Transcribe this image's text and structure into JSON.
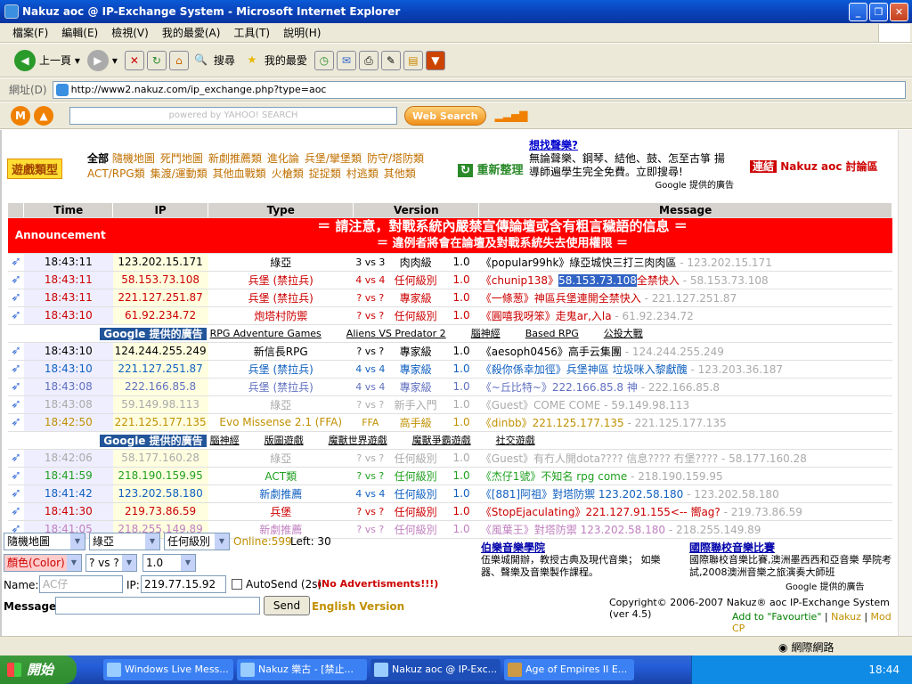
{
  "window": {
    "title": "Nakuz aoc @ IP-Exchange System - Microsoft Internet Explorer",
    "menu": [
      "檔案(F)",
      "編輯(E)",
      "檢視(V)",
      "我的最愛(A)",
      "工具(T)",
      "說明(H)"
    ],
    "toolbar": {
      "back": "上一頁",
      "search": "搜尋",
      "favorites": "我的最愛"
    },
    "address_label": "網址(D)",
    "url": "http://www2.nakuz.com/ip_exchange.php?type=aoc",
    "yahoo_placeholder": "powered by YAHOO! SEARCH",
    "web_search": "Web Search",
    "status_zone": "網際網路"
  },
  "header": {
    "category_badge": "遊戲類型",
    "all": "全部",
    "categories": [
      "隨機地圖",
      "死鬥地圖",
      "新劇推薦類",
      "進化論",
      "兵堡/攣堡類",
      "防守/塔防類",
      "ACT/RPG類",
      "集渡/運動類",
      "其他血戰類",
      "火槍類",
      "捉捉類",
      "村逃類",
      "其他類"
    ],
    "refresh": "重新整理",
    "ad_title": "想找聲樂?",
    "ad_body": "無論聲樂、鋼琴、結他、鼓、怎至古箏 揚 導師遍學生完全免費。立即搜尋!",
    "ad_by": "Google 提供的廣告",
    "link_label": "連結",
    "link_text": "Nakuz aoc 討論區"
  },
  "table": {
    "headers": [
      "Time",
      "IP",
      "Type",
      "Version",
      "Message"
    ],
    "announcement_label": "Announcement",
    "announcement_1": "＝ 請注意，對戰系統內嚴禁宣傳論壇或含有粗言穢語的信息 ＝",
    "announcement_2": "＝ 違例者將會在論壇及對戰系統失去使用權限 ＝",
    "rows_a": [
      {
        "time": "18:43:11",
        "ip": "123.202.15.171",
        "type": "綠亞",
        "mode": "3 vs 3",
        "level": "肉肉級",
        "ver": "1.0",
        "msg": "《popular99hk》綠亞城快三打三肉肉區",
        "trail": " - 123.202.15.171",
        "color": "#000000"
      },
      {
        "time": "18:43:11",
        "ip": "58.153.73.108",
        "type": "兵堡 (禁拉兵)",
        "mode": "4 vs 4",
        "level": "任何級別",
        "ver": "1.0",
        "msg": "《chunip138》",
        "msg_sel": "58.153.73.108",
        "msg_tail": "全禁快入",
        "trail": " - 58.153.73.108",
        "color": "#cc0000"
      },
      {
        "time": "18:43:11",
        "ip": "221.127.251.87",
        "type": "兵堡 (禁拉兵)",
        "mode": "? vs ?",
        "level": "專家級",
        "ver": "1.0",
        "msg": "《一條葱》神區兵堡連開全禁快入",
        "trail": " - 221.127.251.87",
        "color": "#cc0000"
      },
      {
        "time": "18:43:10",
        "ip": "61.92.234.72",
        "type": "炮塔村防禦",
        "mode": "? vs ?",
        "level": "任何級別",
        "ver": "1.0",
        "msg": "《圓嘻我呀笨》走鬼ar,入la",
        "trail": " - 61.92.234.72",
        "color": "#cc0000"
      }
    ],
    "ad1": {
      "google": "Google 提供的廣告",
      "links": [
        "RPG Adventure Games",
        "Aliens VS Predator 2",
        "腦神經",
        "Based RPG",
        "公投大戰"
      ]
    },
    "rows_b": [
      {
        "time": "18:43:10",
        "ip": "124.244.255.249",
        "type": "新信長RPG",
        "mode": "? vs ?",
        "level": "專家級",
        "ver": "1.0",
        "msg": "《aesoph0456》高手云集團",
        "trail": " - 124.244.255.249",
        "color": "#000000"
      },
      {
        "time": "18:43:10",
        "ip": "221.127.251.87",
        "type": "兵堡 (禁拉兵)",
        "mode": "4 vs 4",
        "level": "專家級",
        "ver": "1.0",
        "msg": "《殺你係幸加徑》兵堡神區 垃圾咪入黎獻醜",
        "trail": " - 123.203.36.187",
        "color": "#1060c0"
      },
      {
        "time": "18:43:08",
        "ip": "222.166.85.8",
        "type": "兵堡 (禁拉兵)",
        "mode": "4 vs 4",
        "level": "專家級",
        "ver": "1.0",
        "msg": "《~丘比特~》222.166.85.8 神",
        "trail": " - 222.166.85.8",
        "color": "#6070c0"
      },
      {
        "time": "18:43:08",
        "ip": "59.149.98.113",
        "type": "綠亞",
        "mode": "? vs ?",
        "level": "新手入門",
        "ver": "1.0",
        "msg": "《Guest》COME COME",
        "trail": " - 59.149.98.113",
        "color": "#aaaaaa"
      },
      {
        "time": "18:42:50",
        "ip": "221.125.177.135",
        "type": "Evo Missense 2.1 (FFA)",
        "mode": "FFA",
        "level": "高手級",
        "ver": "1.0",
        "msg": "《dinbb》221.125.177.135",
        "trail": " - 221.125.177.135",
        "color": "#c09000"
      }
    ],
    "ad2": {
      "google": "Google 提供的廣告",
      "links": [
        "腦神經",
        "版圖遊戲",
        "魔獸世界遊戲",
        "魔獸爭霸遊戲",
        "社交遊戲"
      ]
    },
    "rows_c": [
      {
        "time": "18:42:06",
        "ip": "58.177.160.28",
        "type": "綠亞",
        "mode": "? vs ?",
        "level": "任何級別",
        "ver": "1.0",
        "msg": "《Guest》有冇人開dota???? 信息???? 冇堡????",
        "trail": " - 58.177.160.28",
        "color": "#aaaaaa"
      },
      {
        "time": "18:41:59",
        "ip": "218.190.159.95",
        "type": "ACT類",
        "mode": "? vs ?",
        "level": "任何級別",
        "ver": "1.0",
        "msg": "《杰仔1號》不知名 rpg come",
        "trail": " - 218.190.159.95",
        "color": "#20a020"
      },
      {
        "time": "18:41:42",
        "ip": "123.202.58.180",
        "type": "新劇推薦",
        "mode": "4 vs 4",
        "level": "任何級別",
        "ver": "1.0",
        "msg": "《[881]阿祖》對塔防禦 123.202.58.180",
        "trail": " - 123.202.58.180",
        "color": "#1060c0"
      },
      {
        "time": "18:41:30",
        "ip": "219.73.86.59",
        "type": "兵堡",
        "mode": "? vs ?",
        "level": "任何級別",
        "ver": "1.0",
        "msg": "《StopEjaculating》221.127.91.155<-- 嚮ag?",
        "trail": " - 219.73.86.59",
        "color": "#cc0000"
      },
      {
        "time": "18:41:05",
        "ip": "218.255.149.89",
        "type": "新劇推薦",
        "mode": "? vs ?",
        "level": "任何級別",
        "ver": "1.0",
        "msg": "《風葉王》對塔防禦 123.202.58.180",
        "trail": " - 218.255.149.89",
        "color": "#c080c0"
      }
    ]
  },
  "form": {
    "map": "隨機地圖",
    "type": "綠亞",
    "level": "任何級別",
    "online": "Online:599",
    "left": "Left: 30",
    "color": "顏色(Color)",
    "mode": "? vs ?",
    "ver": "1.0",
    "name_label": "Name:",
    "name_placeholder": "AC仔",
    "ip_label": "IP:",
    "ip_value": "219.77.15.92",
    "autosend": "AutoSend (2s)",
    "no_ads": "(No Advertisments!!!)",
    "msg_label": "Message:",
    "send": "Send",
    "english": "English Version"
  },
  "footer": {
    "ad1_title": "伯樂音樂學院",
    "ad1_body": "伍樂城開辦，教授古典及現代音樂； 如樂器、聲樂及音樂製作課程。",
    "ad2_title": "國際聯校音樂比賽",
    "ad2_body": "國際聯校音樂比賽,澳洲墨西西和亞音樂 學院考試,2008澳洲音樂之旅演奏大師班",
    "ad_by": "Google 提供的廣告",
    "copyright": "Copyright© 2006-2007 Nakuz® aoc IP-Exchange System (ver 4.5)",
    "fav": "Add to \"Favourtie\"",
    "nakuz": "Nakuz",
    "modcp": "Mod CP"
  },
  "taskbar": {
    "start": "開始",
    "tasks": [
      "Windows Live Mess...",
      "Nakuz 樂古 - [禁止...",
      "Nakuz aoc @ IP-Exc...",
      "Age of Empires II E..."
    ],
    "clock": "18:44"
  }
}
